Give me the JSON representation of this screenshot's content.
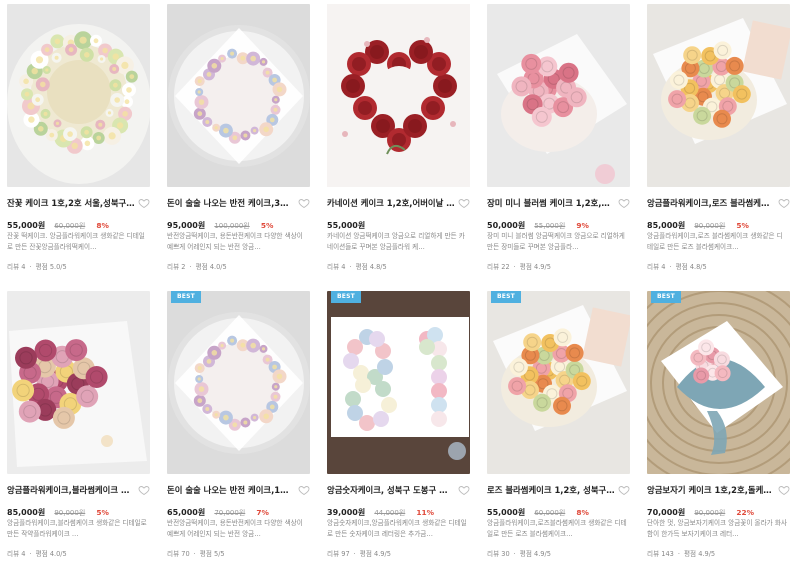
{
  "products": [
    {
      "title": "잔꽃 케이크 1호,2호 서울,성북구,…",
      "price": "55,000원",
      "original_price": "60,000원",
      "discount": "8%",
      "desc": "잔꽃 떡케이크. 앙금플라워케이크 생화같은 디테일로 만든 잔꽃앙금플라워떡케이…",
      "reviews_label": "리뷰",
      "reviews": "4",
      "rating_label": "평점",
      "rating": "5.0/5",
      "best": false,
      "art": "wreath"
    },
    {
      "title": "돈이 술술 나오는 반전 케이크,3…",
      "price": "95,000원",
      "original_price": "100,000원",
      "discount": "5%",
      "desc": "반전앙금떡케이크, 용돈반전케이크 다양한 색상이 예쁘게 어레인지 되는 반전 앙금…",
      "reviews_label": "리뷰",
      "reviews": "2",
      "rating_label": "평점",
      "rating": "4.0/5",
      "best": false,
      "art": "ringplate"
    },
    {
      "title": "카네이션 케이크 1,2호,어버이날 …",
      "price": "55,000원",
      "original_price": "",
      "discount": "",
      "desc": "카네이션 앙금떡케이크 앙금으로 리얼하게 만든 카네이션들로 꾸며본 앙금플라워 케…",
      "reviews_label": "리뷰",
      "reviews": "4",
      "rating_label": "평점",
      "rating": "4.8/5",
      "best": false,
      "art": "heart"
    },
    {
      "title": "장미 미니 블러썸 케이크 1,2호,…",
      "price": "50,000원",
      "original_price": "55,000원",
      "discount": "9%",
      "desc": "장미 미니 블러썸 앙금떡케이크 앙금으로 리얼하게 만든 장미들로 꾸며본 앙금플라…",
      "reviews_label": "리뷰",
      "reviews": "22",
      "rating_label": "평점",
      "rating": "4.9/5",
      "best": false,
      "art": "pinkmini"
    },
    {
      "title": "앙금플라워케이크,로즈 블라썸케…",
      "price": "85,000원",
      "original_price": "90,000원",
      "discount": "5%",
      "desc": "앙금플라워케이크,로즈 블라썸케이크 생화같은 디테일로 만든 로즈 블라썸케이크…",
      "reviews_label": "리뷰",
      "reviews": "4",
      "rating_label": "평점",
      "rating": "4.8/5",
      "best": false,
      "art": "bouquet"
    },
    {
      "title": "앙금플라워케이크,블라썸케이크 …",
      "price": "85,000원",
      "original_price": "90,000원",
      "discount": "5%",
      "desc": "앙금플라워케이크,블라썸케이크 생화같은 디테일로 만든 작약플라워케이크 …",
      "reviews_label": "리뷰",
      "reviews": "4",
      "rating_label": "평점",
      "rating": "4.0/5",
      "best": false,
      "art": "peony"
    },
    {
      "title": "돈이 술술 나오는 반전 케이크,1…",
      "price": "65,000원",
      "original_price": "70,000원",
      "discount": "7%",
      "desc": "반전앙금떡케이크, 용돈반전케이크 다양한 색상이 예쁘게 어레인지 되는 반전 앙금…",
      "reviews_label": "리뷰",
      "reviews": "70",
      "rating_label": "평점",
      "rating": "5/5",
      "best": true,
      "art": "ringplate"
    },
    {
      "title": "앙금숫자케이크, 성북구 도봉구 …",
      "price": "39,000원",
      "original_price": "44,000원",
      "discount": "11%",
      "desc": "앙금숫자케이크,앙금플라워케이크 생화같은 디테일로 만든 숫자케이크 레터링은 추가금…",
      "reviews_label": "리뷰",
      "reviews": "97",
      "rating_label": "평점",
      "rating": "4.9/5",
      "best": true,
      "art": "number"
    },
    {
      "title": "로즈 블라썸케이크 1,2호, 성북구 …",
      "price": "55,000원",
      "original_price": "60,000원",
      "discount": "8%",
      "desc": "앙금플라워케이크,로즈블라썸케이크 생화같은 디테일로 만든 로즈 블라썸케이크…",
      "reviews_label": "리뷰",
      "reviews": "30",
      "rating_label": "평점",
      "rating": "4.9/5",
      "best": true,
      "art": "bouquet"
    },
    {
      "title": "앙금보자기 케이크 1호,2호,돌케…",
      "price": "70,000원",
      "original_price": "90,000원",
      "discount": "22%",
      "desc": "단아한 멋, 앙금보자기케이크 앙금꽃이 올라가 화사함이 한가득 보자기케이크 레터…",
      "reviews_label": "리뷰",
      "reviews": "143",
      "rating_label": "평점",
      "rating": "4.9/5",
      "best": true,
      "art": "bojagi"
    }
  ],
  "best_label": "BEST"
}
